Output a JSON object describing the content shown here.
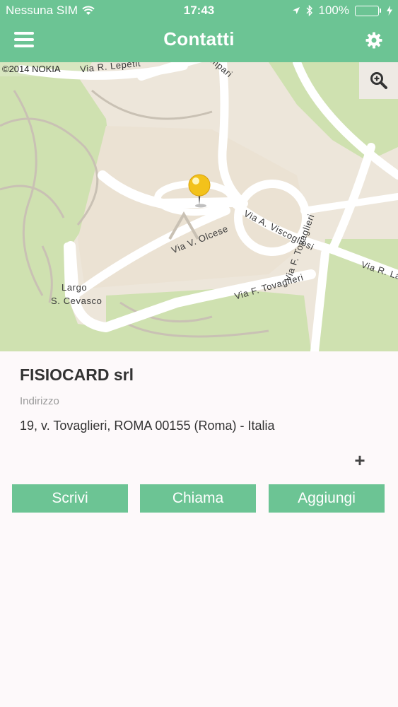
{
  "status_bar": {
    "carrier": "Nessuna SIM",
    "time": "17:43",
    "battery": "100%"
  },
  "nav": {
    "title": "Contatti"
  },
  "map": {
    "copyright": "©2014 NOKIA",
    "streets": {
      "lepetit": "Via R. Lepetit",
      "campari": "Campari",
      "olcese": "Via V. Olcese",
      "viscogliosi": "Via A. Viscogliosi",
      "tovaglieri": "Via F. Tovaglieri",
      "tovaglieri2": "Via F. Tovaglieri",
      "lanciani": "Via R. La",
      "largo1": "Largo",
      "largo2": "S. Cevasco"
    }
  },
  "contact": {
    "name": "FISIOCARD srl",
    "address_label": "Indirizzo",
    "address": "19, v. Tovaglieri, ROMA 00155 (Roma) - Italia"
  },
  "actions": {
    "plus": "+",
    "write": "Scrivi",
    "call": "Chiama",
    "add": "Aggiungi"
  },
  "colors": {
    "primary": "#6cc494",
    "map_background": "#ede6da",
    "park": "#cfe1b0"
  }
}
